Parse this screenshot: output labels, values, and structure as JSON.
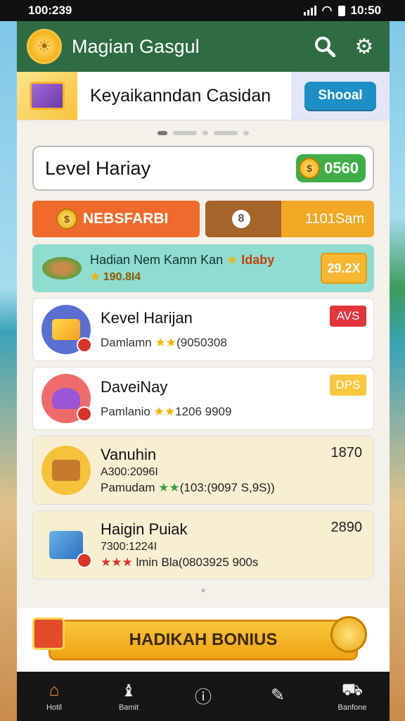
{
  "status": {
    "time": "100:239",
    "right_time": "10:50"
  },
  "header": {
    "title": "Magian Gasgul"
  },
  "banner": {
    "text": "Keyaikanndan Casidan",
    "button": "Shooal"
  },
  "level": {
    "title": "Level Hariay",
    "coins": "0560"
  },
  "tabs": {
    "left_label": "NEBSFARBI",
    "right_label": "1101Sam"
  },
  "promo": {
    "line1_a": "Hadian Nem Kamn Kan",
    "line1_b": "Idaby",
    "line2": "190.8I4",
    "badge": "29.2X"
  },
  "items": [
    {
      "title": "Kevel Harijan",
      "sub": "Damlamn",
      "sub_value": "(9050308",
      "tag": "AVS"
    },
    {
      "title": "DaveiNay",
      "sub": "Pamlanio",
      "sub_value": "1206 9909",
      "tag": "DPS"
    },
    {
      "title": "Vanuhin",
      "line2": "A300:2096I",
      "sub": "Pamudam",
      "sub_value": "(103:(9097 S,9S))",
      "num": "1870"
    },
    {
      "title": "Haigin Puiak",
      "line2": "7300:1224I",
      "sub": "lmin Bla(0803925 900s",
      "num": "2890"
    }
  ],
  "bonus": {
    "label": "HADIKAH BONIUS"
  },
  "nav": [
    {
      "label": "Hotil",
      "icon": "home-icon"
    },
    {
      "label": "Bamit",
      "icon": "gift-icon"
    },
    {
      "label": "",
      "icon": "info-icon"
    },
    {
      "label": "",
      "icon": "edit-icon"
    },
    {
      "label": "Banfone",
      "icon": "bag-icon"
    }
  ],
  "colors": {
    "header": "#2f6b43",
    "accent_orange": "#ef6a2c",
    "accent_green": "#3fae48",
    "accent_gold": "#f7b731"
  }
}
